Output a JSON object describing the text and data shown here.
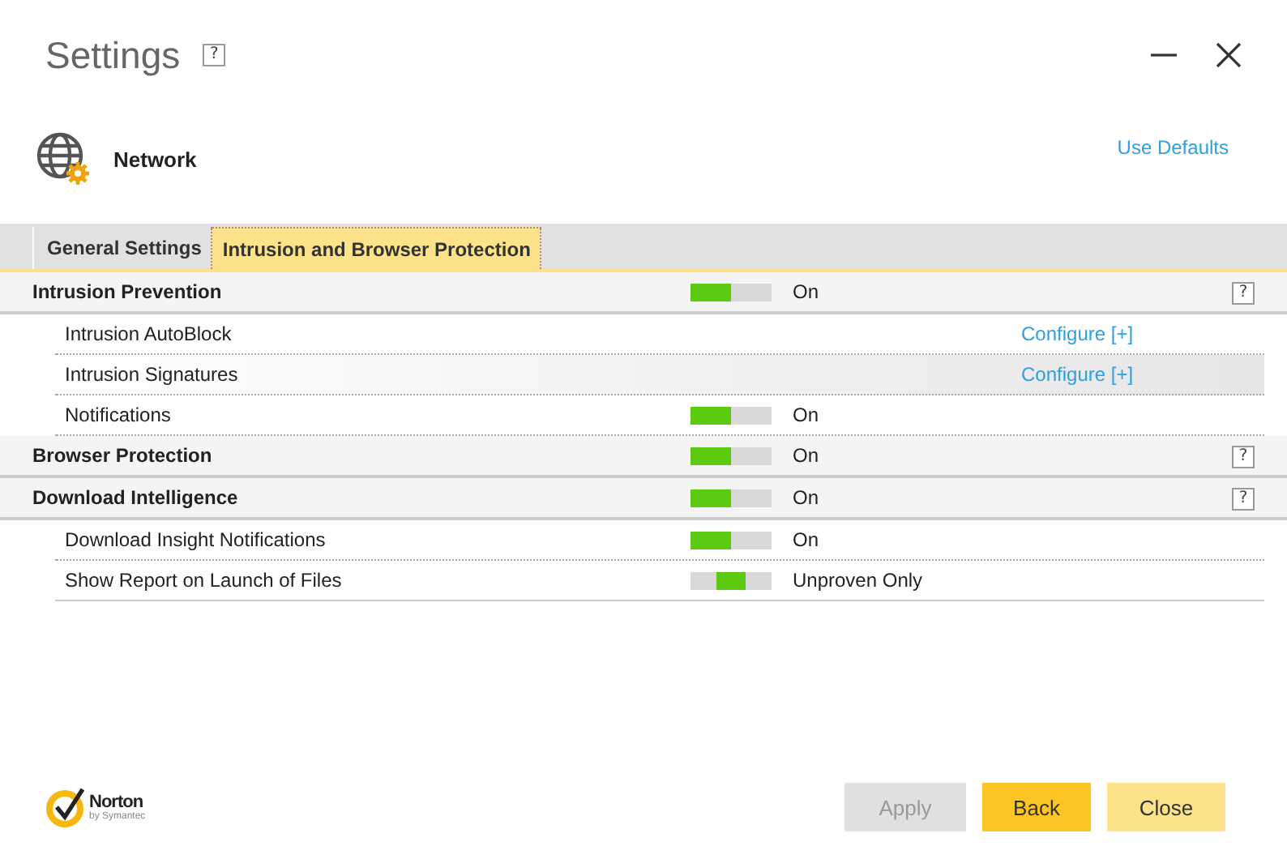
{
  "window": {
    "title": "Settings",
    "help": "?"
  },
  "header": {
    "title": "Network",
    "link": "Use Defaults"
  },
  "tabs": [
    {
      "label": "General Settings",
      "selected": false
    },
    {
      "label": "Intrusion and Browser Protection",
      "selected": true
    }
  ],
  "rows": [
    {
      "kind": "section",
      "label": "Intrusion Prevention",
      "switch": true,
      "middle_position": false,
      "value": "On",
      "help": "?",
      "highlighted": false
    },
    {
      "kind": "item",
      "label": "Intrusion AutoBlock",
      "link": "Configure [+]",
      "highlighted": false
    },
    {
      "kind": "item",
      "label": "Intrusion Signatures",
      "link": "Configure [+]",
      "highlighted": true
    },
    {
      "kind": "item",
      "label": "Notifications",
      "switch": true,
      "middle_position": false,
      "value": "On",
      "highlighted": false
    },
    {
      "kind": "section",
      "label": "Browser Protection",
      "switch": true,
      "middle_position": false,
      "value": "On",
      "help": "?",
      "highlighted": false
    },
    {
      "kind": "section",
      "label": "Download Intelligence",
      "switch": true,
      "middle_position": false,
      "value": "On",
      "help": "?",
      "highlighted": false
    },
    {
      "kind": "item",
      "label": "Download Insight Notifications",
      "switch": true,
      "middle_position": false,
      "value": "On",
      "highlighted": false
    },
    {
      "kind": "item",
      "label": "Show Report on Launch of Files",
      "switch": true,
      "middle_position": true,
      "value": "Unproven Only",
      "highlighted": false
    }
  ],
  "logo": {
    "name": "Norton",
    "sub": "by Symantec"
  },
  "buttons": [
    {
      "label": "Apply",
      "kind": "disabled"
    },
    {
      "label": "Back",
      "kind": "primary"
    },
    {
      "label": "Close",
      "kind": "secondary"
    }
  ]
}
